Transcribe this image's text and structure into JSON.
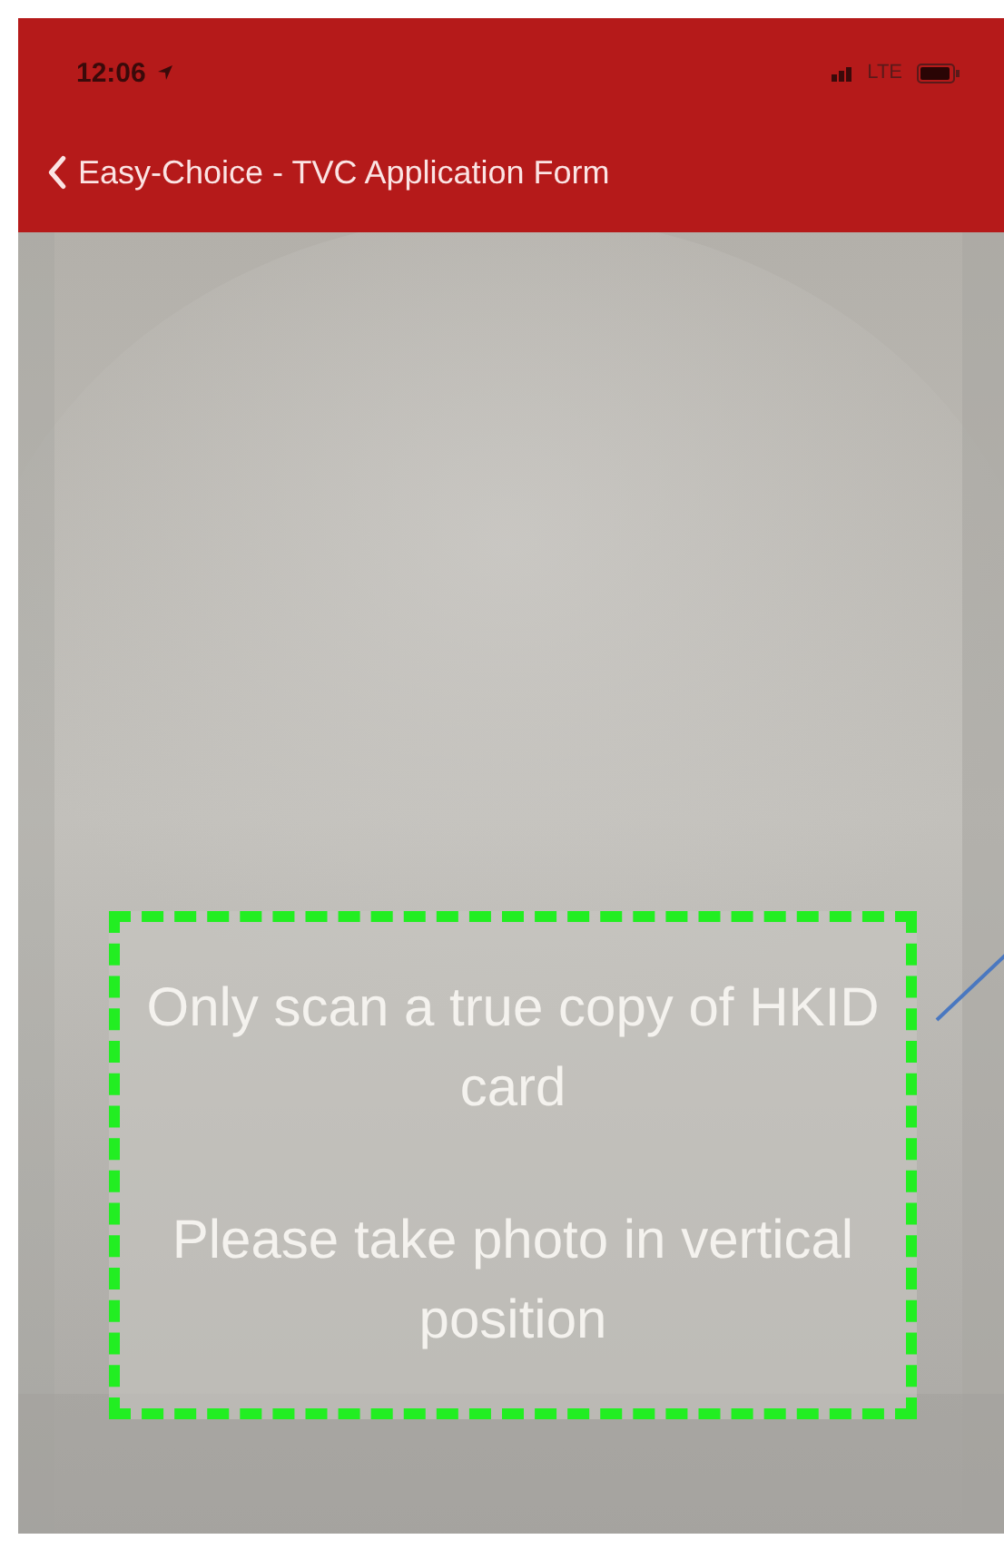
{
  "status_bar": {
    "time": "12:06",
    "network": "LTE"
  },
  "nav_bar": {
    "title": "Easy-Choice - TVC Application Form"
  },
  "scan_frame": {
    "messages": [
      "Only scan a true copy of HKID card",
      "Please take photo in vertical position"
    ]
  }
}
